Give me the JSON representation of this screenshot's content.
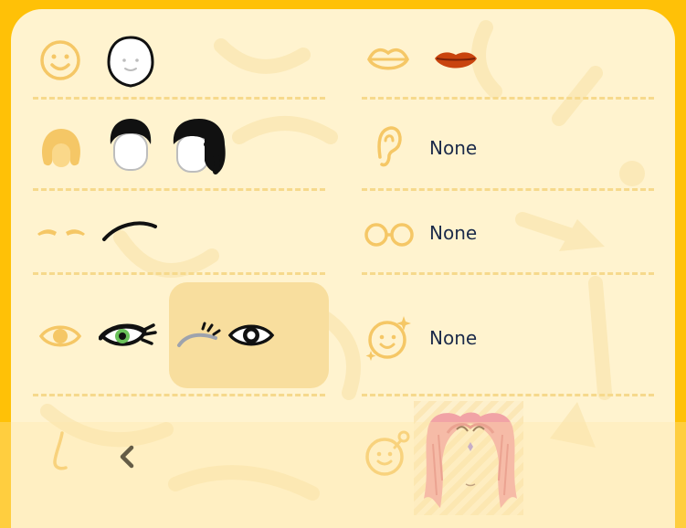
{
  "left_categories": [
    {
      "id": "face",
      "icon": "face-icon"
    },
    {
      "id": "hair",
      "icon": "hair-icon"
    },
    {
      "id": "eyebrows",
      "icon": "eyebrows-icon"
    },
    {
      "id": "eyes",
      "icon": "eye-icon"
    },
    {
      "id": "nose",
      "icon": "nose-icon"
    }
  ],
  "right_categories": [
    {
      "id": "mouth",
      "icon": "lips-icon"
    },
    {
      "id": "ears",
      "icon": "ear-icon",
      "value": "None"
    },
    {
      "id": "glasses",
      "icon": "glasses-icon",
      "value": "None"
    },
    {
      "id": "extras",
      "icon": "sparkle-face-icon",
      "value": "None"
    },
    {
      "id": "accessory",
      "icon": "face-accessory-icon"
    }
  ],
  "colors": {
    "frame": "#FFC107",
    "panel": "#FFF3CF",
    "icon": "#F5C766",
    "text": "#1C2B4A",
    "selected": "#F8DE9E",
    "lips": "#C9440E",
    "eye_green": "#6BC25B",
    "hair_pink": "#F1A3A6"
  }
}
